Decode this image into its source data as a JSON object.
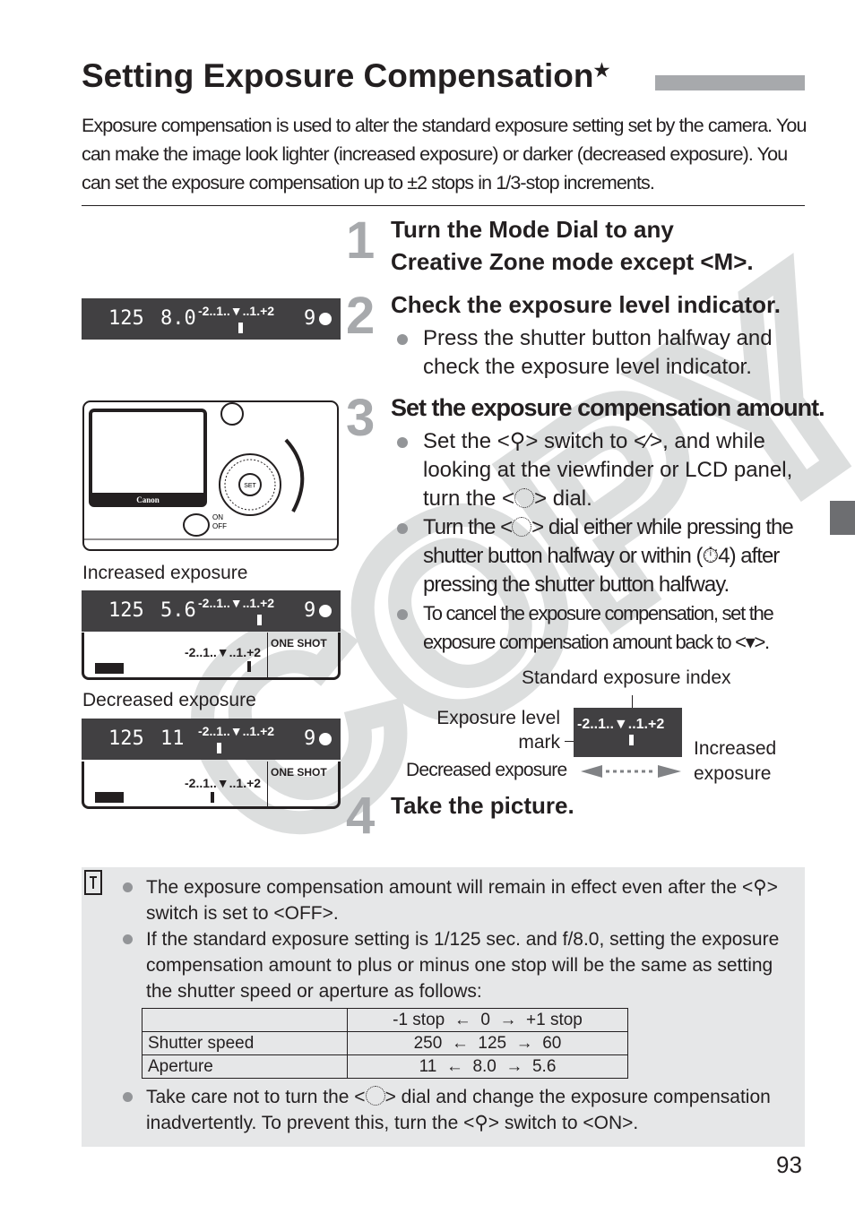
{
  "title": "Setting Exposure Compensation",
  "title_star": "★",
  "intro": "Exposure compensation is used to alter the standard exposure setting set by the camera. You can make the image look lighter (increased exposure) or darker (decreased exposure). You can set the exposure compensation up to ±2 stops in 1/3-stop increments.",
  "steps": [
    {
      "num": "1",
      "head_line1": "Turn the Mode Dial to any",
      "head_line2": "Creative Zone mode except <",
      "head_icon": "M",
      "head_end": ">."
    },
    {
      "num": "2",
      "head": "Check the exposure level indicator.",
      "bullet1": "Press the shutter button halfway and check the exposure level indicator."
    },
    {
      "num": "3",
      "head": "Set the exposure compensation amount.",
      "b1a": "Set the <",
      "b1b": "> switch to <",
      "b1c": ">, and while looking at the viewfinder or LCD panel, turn the <",
      "b1d": "> dial.",
      "b2a": "Turn the <",
      "b2b": "> dial either while pressing the shutter button halfway or within (",
      "b2timer": "⏱4",
      "b2c": ") after pressing the shutter button halfway.",
      "b3a": "To cancel the exposure compensation, set the exposure compensation amount back to <",
      "b3b": ">."
    },
    {
      "num": "4",
      "head": "Take the picture."
    }
  ],
  "icons": {
    "lock_switch": "multi-function-lock-icon",
    "dial": "quick-control-dial-icon",
    "on_switch": "lock-on-icon",
    "timer": "timer-icon",
    "note": "note-icon",
    "index": "standard-index-icon"
  },
  "lcd": {
    "shutter": "125",
    "aperture_std": "8.0",
    "aperture_inc": "5.6",
    "aperture_dec": "11",
    "scale": "-2..1..▼..1.+2",
    "shots": "9",
    "camera_brand": "Canon",
    "set_label": "SET",
    "switch_on": "ON",
    "switch_off": "OFF",
    "one_shot": "ONE SHOT"
  },
  "labels": {
    "increased": "Increased exposure",
    "decreased": "Decreased exposure"
  },
  "diagram": {
    "index": "Standard exposure index",
    "mark": "Exposure level mark",
    "decreased": "Decreased exposure",
    "increased": "Increased exposure"
  },
  "note": {
    "b1a": "The exposure compensation amount will remain in effect even after the <",
    "b1b": "> switch is set to <",
    "b1off": "OFF",
    "b1c": ">.",
    "b2": "If the standard exposure setting is 1/125 sec. and f/8.0, setting the exposure compensation amount to plus or minus one stop will be the same as setting the shutter speed or aperture as follows:",
    "b3a": "Take care not to turn the <",
    "b3b": "> dial and change the exposure compensation inadvertently. To prevent this, turn the <",
    "b3c": "> switch to <",
    "b3on": "ON",
    "b3d": ">."
  },
  "table": {
    "header": [
      "",
      "-1 stop  ←  0  →  +1 stop"
    ],
    "rows": [
      [
        "Shutter speed",
        "250  ←  125  →  60"
      ],
      [
        "Aperture",
        "11  ←  8.0  →  5.6"
      ]
    ]
  },
  "watermark": "COPY",
  "page_number": "93"
}
